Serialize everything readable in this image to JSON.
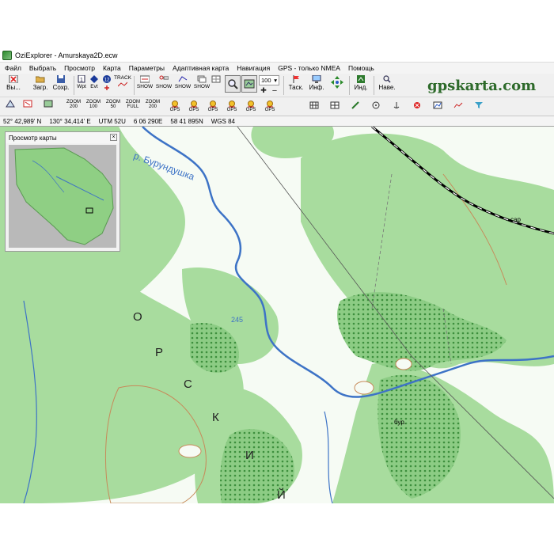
{
  "window": {
    "title": "OziExplorer - Amurskaya2D.ecw"
  },
  "menu": [
    "Файл",
    "Выбрать",
    "Просмотр",
    "Карта",
    "Параметры",
    "Адаптивная карта",
    "Навигация",
    "GPS - только NMEA",
    "Помощь"
  ],
  "toolbar1": {
    "exit_label": "Вы...",
    "load_label": "Загр.",
    "save_label": "Сохр.",
    "wpt_label": "Wpt",
    "evt_label": "Evt",
    "track_label": "TRACK",
    "show_label": "SHOW",
    "zoom_value": "100",
    "task_label": "Таск.",
    "info_label": "Инф.",
    "ind_label": "Инд.",
    "nav_label": "Наве."
  },
  "toolbar2": {
    "zoom_buttons": [
      "200",
      "100",
      "50",
      "FULL",
      "200"
    ],
    "zoom_prefix": "ZOOM",
    "gps_label": "GPS"
  },
  "brand": "gpskarta.com",
  "status": {
    "lat": "52° 42,989' N",
    "lon": "130° 34,414' E",
    "utm": "UTM  52U",
    "easting": "6 06 290E",
    "northing": "58 41 895N",
    "datum": "WGS 84"
  },
  "overview": {
    "title": "Просмотр карты"
  },
  "map_labels": {
    "river": "р. Бурундушка",
    "elevation": "245",
    "vertical": [
      "О",
      "Р",
      "С",
      "К",
      "И",
      "Й"
    ],
    "rail": "сар",
    "place": "бур."
  },
  "colors": {
    "forest": "#a8dc9e",
    "dense_forest": "#6fbf6b",
    "open": "#f6fbf4",
    "river": "#3d73c6",
    "contour": "#c78a5a"
  }
}
